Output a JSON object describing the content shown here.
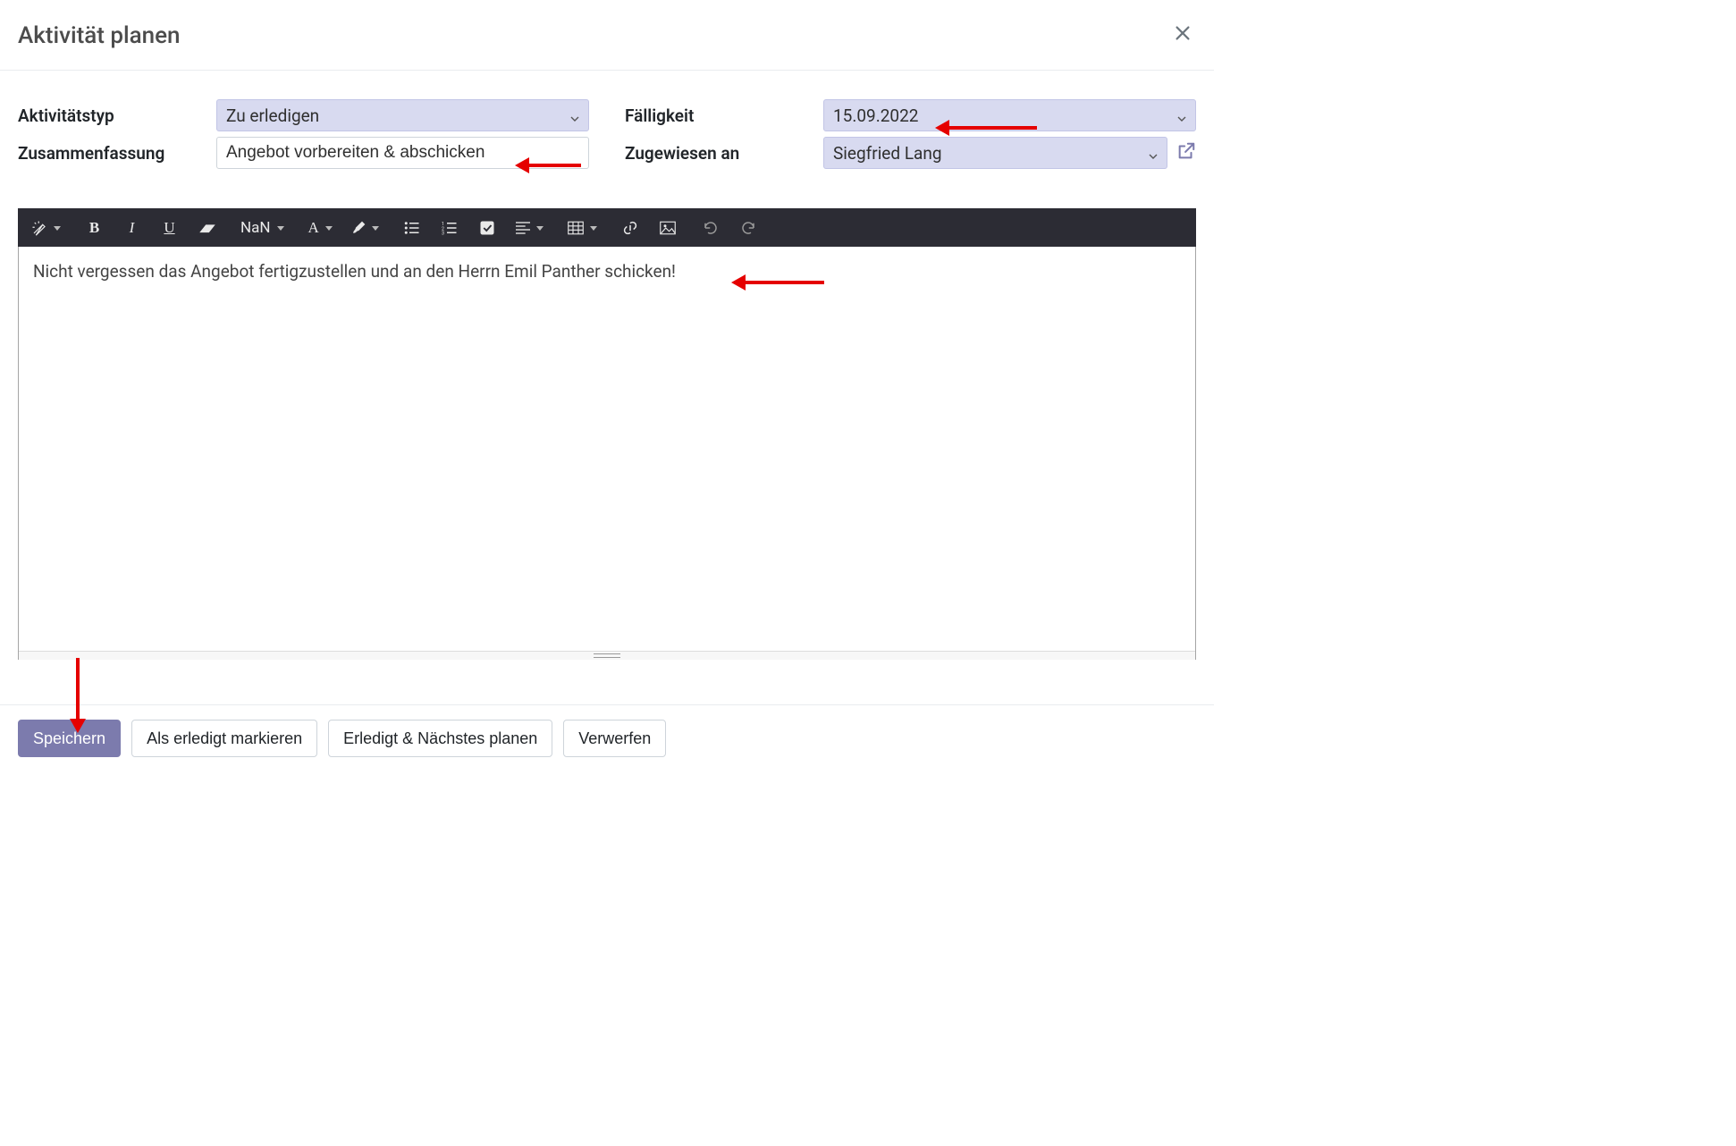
{
  "modal": {
    "title": "Aktivität planen"
  },
  "form": {
    "activity_type_label": "Aktivitätstyp",
    "activity_type_value": "Zu erledigen",
    "summary_label": "Zusammenfassung",
    "summary_value": "Angebot vorbereiten & abschicken",
    "due_label": "Fälligkeit",
    "due_value": "15.09.2022",
    "assigned_label": "Zugewiesen an",
    "assigned_value": "Siegfried Lang"
  },
  "toolbar": {
    "font_size_label": "NaN"
  },
  "editor": {
    "content": "Nicht vergessen das Angebot fertigzustellen und an den Herrn Emil Panther schicken!"
  },
  "footer": {
    "save": "Speichern",
    "mark_done": "Als erledigt markieren",
    "done_next": "Erledigt & Nächstes planen",
    "discard": "Verwerfen"
  }
}
